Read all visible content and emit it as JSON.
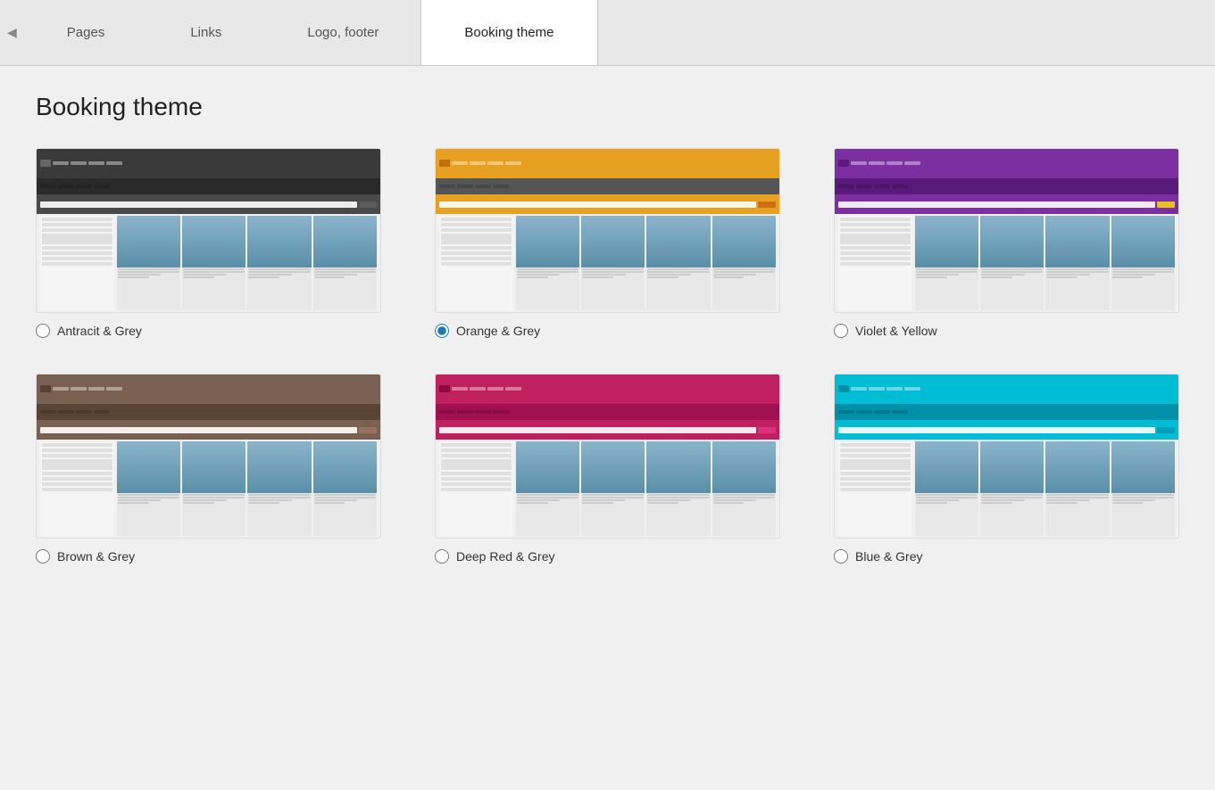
{
  "tabs": [
    {
      "id": "pages",
      "label": "Pages",
      "active": false
    },
    {
      "id": "links",
      "label": "Links",
      "active": false
    },
    {
      "id": "logo-footer",
      "label": "Logo, footer",
      "active": false
    },
    {
      "id": "booking-theme",
      "label": "Booking theme",
      "active": true
    }
  ],
  "page_title": "Booking theme",
  "themes": [
    {
      "id": "antracit",
      "label": "Antracit & Grey",
      "color_class": "theme-antracit",
      "selected": false
    },
    {
      "id": "orange",
      "label": "Orange & Grey",
      "color_class": "theme-orange",
      "selected": true
    },
    {
      "id": "violet",
      "label": "Violet & Yellow",
      "color_class": "theme-violet",
      "selected": false
    },
    {
      "id": "brown",
      "label": "Brown & Grey",
      "color_class": "theme-brown",
      "selected": false
    },
    {
      "id": "deepred",
      "label": "Deep Red & Grey",
      "color_class": "theme-deepred",
      "selected": false
    },
    {
      "id": "blue",
      "label": "Blue & Grey",
      "color_class": "theme-blue",
      "selected": false
    }
  ]
}
